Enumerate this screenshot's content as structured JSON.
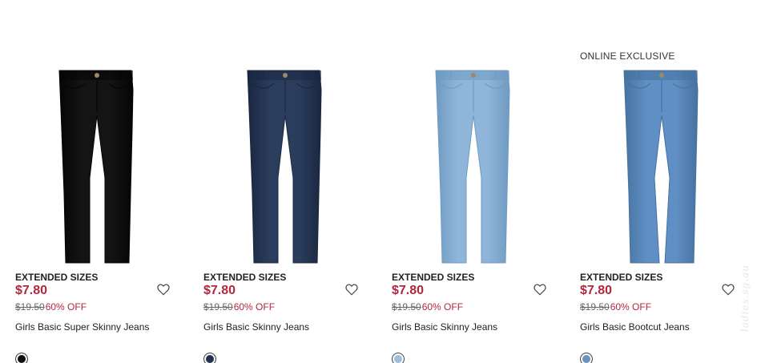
{
  "products": [
    {
      "badge": "",
      "tag": "EXTENDED SIZES",
      "price": "$7.80",
      "original_price": "$19.50",
      "discount": "60% OFF",
      "name": "Girls Basic Super Skinny Jeans",
      "denim_color": "#141414",
      "denim_shade": "#050505",
      "swatch_color": "#111111"
    },
    {
      "badge": "",
      "tag": "EXTENDED SIZES",
      "price": "$7.80",
      "original_price": "$19.50",
      "discount": "60% OFF",
      "name": "Girls Basic Skinny Jeans",
      "denim_color": "#2a3d5c",
      "denim_shade": "#1a2740",
      "swatch_color": "#22324d"
    },
    {
      "badge": "",
      "tag": "EXTENDED SIZES",
      "price": "$7.80",
      "original_price": "$19.50",
      "discount": "60% OFF",
      "name": "Girls Basic Skinny Jeans",
      "denim_color": "#8fb6d8",
      "denim_shade": "#6f9ac2",
      "swatch_color": "#9dbfdc"
    },
    {
      "badge": "ONLINE EXCLUSIVE",
      "tag": "EXTENDED SIZES",
      "price": "$7.80",
      "original_price": "$19.50",
      "discount": "60% OFF",
      "name": "Girls Basic Bootcut Jeans",
      "denim_color": "#5f8fc4",
      "denim_shade": "#46729f",
      "swatch_color": "#6b93bb"
    }
  ],
  "icons": {
    "wishlist": "heart-outline-icon"
  },
  "watermark": "ladies.sg.au"
}
